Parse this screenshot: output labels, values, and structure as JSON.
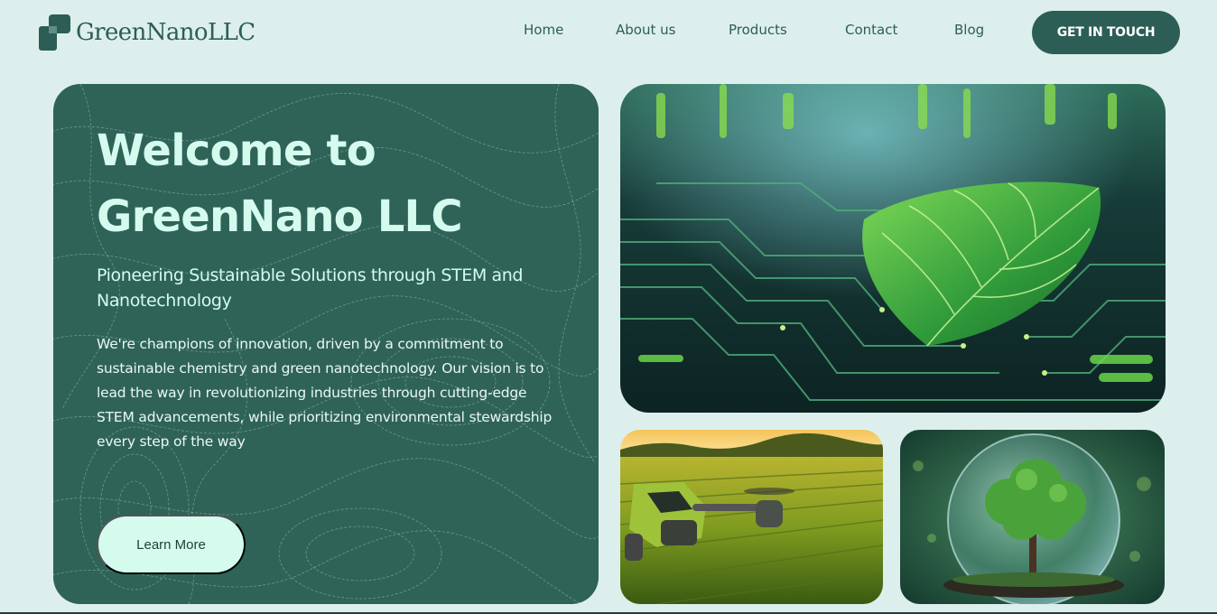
{
  "header": {
    "logo_text": "GreenNanoLLC",
    "nav": [
      {
        "label": "Home"
      },
      {
        "label": "About us"
      },
      {
        "label": "Products"
      },
      {
        "label": "Contact"
      },
      {
        "label": "Blog"
      }
    ],
    "cta_label": "GET IN TOUCH"
  },
  "hero": {
    "title_line1": "Welcome to",
    "title_line2": "GreenNano LLC",
    "subtitle": "Pioneering Sustainable Solutions through STEM and Nanotechnology",
    "body": "We're champions of innovation, driven by a commitment to sustainable chemistry and green nanotechnology. Our vision is to lead the way in revolutionizing industries through cutting-edge STEM advancements, while prioritizing environmental stewardship every step of the way",
    "button_label": "Learn More"
  },
  "images": [
    {
      "subject": "leaf-on-circuit-board"
    },
    {
      "subject": "drone-over-crop-field"
    },
    {
      "subject": "tree-in-glass-globe"
    }
  ],
  "colors": {
    "background": "#ddefed",
    "primary": "#2c5e55",
    "hero_card": "#2f6358",
    "accent_text": "#d4fbee"
  }
}
